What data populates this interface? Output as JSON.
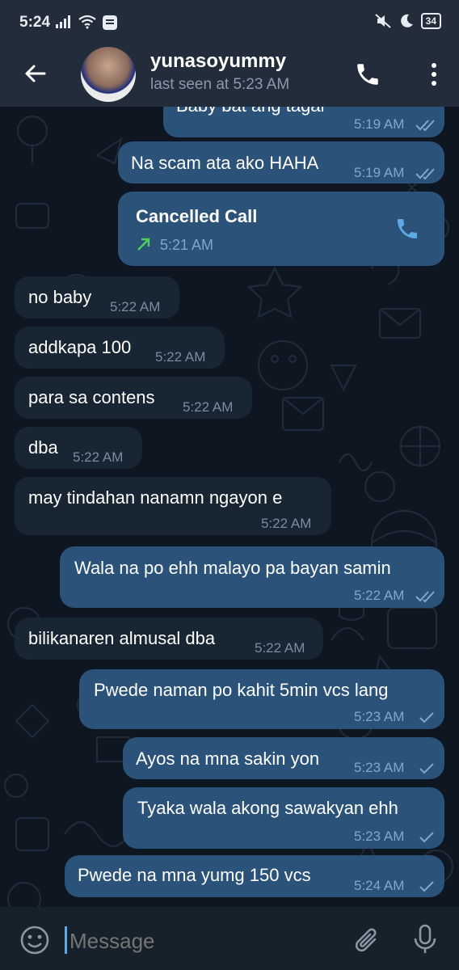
{
  "status": {
    "time": "5:24",
    "battery": "34"
  },
  "header": {
    "name": "yunasoyummy",
    "last_seen": "last seen at 5:23 AM"
  },
  "messages": [
    {
      "dir": "out",
      "text": "Baby bat ang tagal",
      "time": "5:19 AM",
      "ticks": "double"
    },
    {
      "dir": "out",
      "text": "Na scam ata ako HAHA",
      "time": "5:19 AM",
      "ticks": "double"
    },
    {
      "dir": "out",
      "type": "call",
      "text": "Cancelled Call",
      "time": "5:21 AM"
    },
    {
      "dir": "in",
      "text": "no baby",
      "time": "5:22 AM"
    },
    {
      "dir": "in",
      "text": "addkapa 100",
      "time": "5:22 AM"
    },
    {
      "dir": "in",
      "text": "para sa contens",
      "time": "5:22 AM"
    },
    {
      "dir": "in",
      "text": "dba",
      "time": "5:22 AM"
    },
    {
      "dir": "in",
      "text": "may tindahan nanamn ngayon e",
      "time": "5:22 AM"
    },
    {
      "dir": "out",
      "text": "Wala na po ehh malayo pa bayan samin",
      "time": "5:22 AM",
      "ticks": "double"
    },
    {
      "dir": "in",
      "text": "bilikanaren almusal dba",
      "time": "5:22 AM"
    },
    {
      "dir": "out",
      "text": "Pwede naman po kahit 5min vcs lang",
      "time": "5:23 AM",
      "ticks": "single"
    },
    {
      "dir": "out",
      "text": "Ayos na mna sakin yon",
      "time": "5:23 AM",
      "ticks": "single"
    },
    {
      "dir": "out",
      "text": "Tyaka wala akong sawakyan ehh",
      "time": "5:23 AM",
      "ticks": "single"
    },
    {
      "dir": "out",
      "text": "Pwede na mna yumg 150 vcs",
      "time": "5:24 AM",
      "ticks": "single"
    }
  ],
  "input": {
    "placeholder": "Message"
  },
  "colors": {
    "outgoing_bubble": "#2b5278",
    "incoming_bubble": "#182533",
    "background": "#0e1621",
    "accent": "#5ea9e6",
    "call_arrow": "#4fce5d"
  },
  "icons": [
    "back-arrow-icon",
    "phone-icon",
    "more-vertical-icon",
    "emoji-icon",
    "paperclip-icon",
    "microphone-icon",
    "double-check-icon",
    "check-icon",
    "outgoing-arrow-icon"
  ]
}
